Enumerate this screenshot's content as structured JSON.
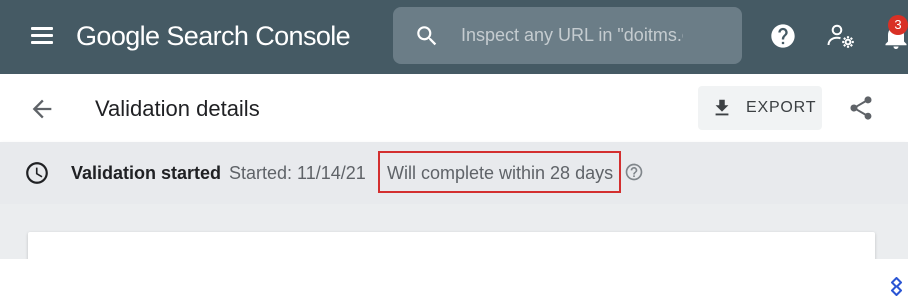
{
  "app": {
    "title": "Google Search Console"
  },
  "search": {
    "placeholder": "Inspect any URL in \"doitms.c"
  },
  "topbar": {
    "notification_count": "3"
  },
  "header": {
    "title": "Validation details",
    "export_label": "EXPORT"
  },
  "status": {
    "title": "Validation started",
    "started": "Started: 11/14/21",
    "completion": "Will complete within 28 days"
  },
  "colors": {
    "topbar": "#455a64",
    "status_bar": "#e8eaed",
    "highlight_box": "#d32f2f",
    "notification_badge": "#d93025"
  },
  "icons": [
    "menu-icon",
    "search-icon",
    "help-icon",
    "manage-users-icon",
    "bell-icon",
    "back-arrow-icon",
    "download-icon",
    "share-icon",
    "clock-icon",
    "info-icon",
    "toptal-logo-icon"
  ]
}
